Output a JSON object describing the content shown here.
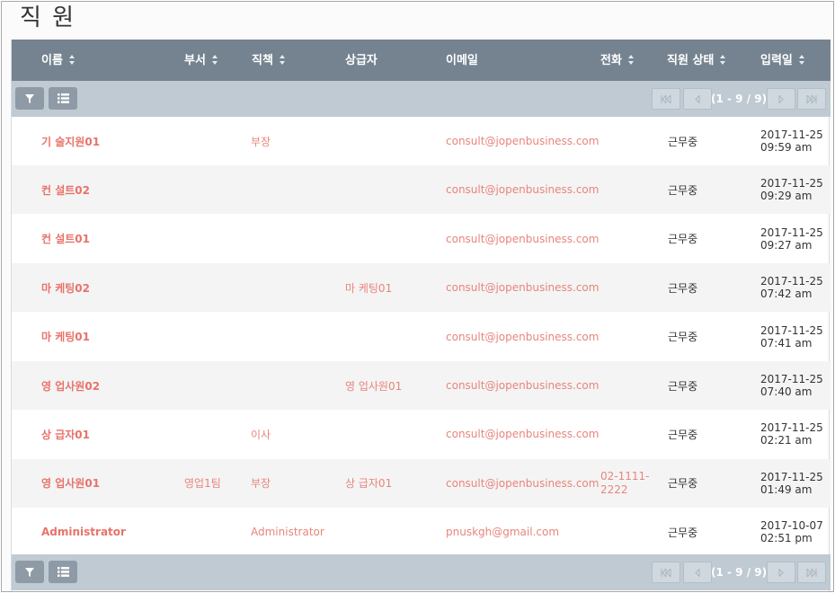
{
  "page": {
    "title": "직 원"
  },
  "columns": [
    {
      "label": "이름",
      "sortable": true
    },
    {
      "label": "부서",
      "sortable": true
    },
    {
      "label": "직책",
      "sortable": true
    },
    {
      "label": "상급자",
      "sortable": false
    },
    {
      "label": "이메일",
      "sortable": false
    },
    {
      "label": "전화",
      "sortable": true
    },
    {
      "label": "직원 상태",
      "sortable": true
    },
    {
      "label": "입력일",
      "sortable": true
    }
  ],
  "pager": {
    "info": "(1 - 9 / 9)"
  },
  "rows": [
    {
      "name": "기 술지원01",
      "dept": "",
      "title": "부장",
      "supervisor": "",
      "email": "consult@jopenbusiness.com",
      "phone": "",
      "status": "근무중",
      "date": "2017-11-25\n09:59 am"
    },
    {
      "name": "컨 설트02",
      "dept": "",
      "title": "",
      "supervisor": "",
      "email": "consult@jopenbusiness.com",
      "phone": "",
      "status": "근무중",
      "date": "2017-11-25\n09:29 am"
    },
    {
      "name": "컨 설트01",
      "dept": "",
      "title": "",
      "supervisor": "",
      "email": "consult@jopenbusiness.com",
      "phone": "",
      "status": "근무중",
      "date": "2017-11-25\n09:27 am"
    },
    {
      "name": "마 케팅02",
      "dept": "",
      "title": "",
      "supervisor": "마 케팅01",
      "email": "consult@jopenbusiness.com",
      "phone": "",
      "status": "근무중",
      "date": "2017-11-25\n07:42 am"
    },
    {
      "name": "마 케팅01",
      "dept": "",
      "title": "",
      "supervisor": "",
      "email": "consult@jopenbusiness.com",
      "phone": "",
      "status": "근무중",
      "date": "2017-11-25\n07:41 am"
    },
    {
      "name": "영 업사원02",
      "dept": "",
      "title": "",
      "supervisor": "영 업사원01",
      "email": "consult@jopenbusiness.com",
      "phone": "",
      "status": "근무중",
      "date": "2017-11-25\n07:40 am"
    },
    {
      "name": "상 급자01",
      "dept": "",
      "title": "이사",
      "supervisor": "",
      "email": "consult@jopenbusiness.com",
      "phone": "",
      "status": "근무중",
      "date": "2017-11-25\n02:21 am"
    },
    {
      "name": "영 업사원01",
      "dept": "영업1팀",
      "title": "부장",
      "supervisor": "상 급자01",
      "email": "consult@jopenbusiness.com",
      "phone": "02-1111-\n2222",
      "status": "근무중",
      "date": "2017-11-25\n01:49 am"
    },
    {
      "name": "Administrator",
      "dept": "",
      "title": "Administrator",
      "supervisor": "",
      "email": "pnuskgh@gmail.com",
      "phone": "",
      "status": "근무중",
      "date": "2017-10-07\n02:51 pm"
    }
  ]
}
